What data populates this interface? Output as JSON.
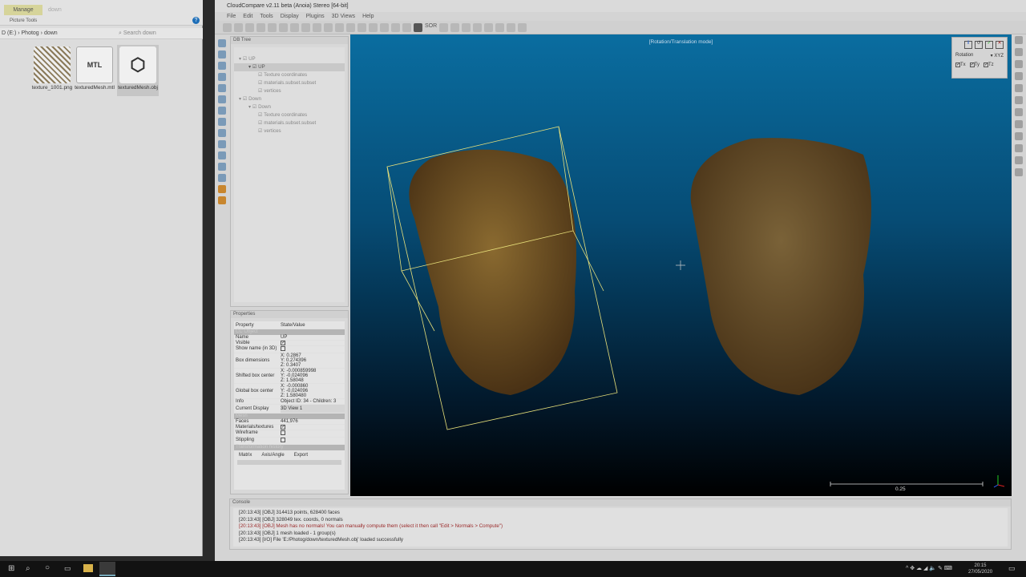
{
  "explorer": {
    "ribbon_tab": "Manage",
    "window_title": "down",
    "ribbon_sub": "Picture Tools",
    "address": [
      "D (E:)",
      "Photog",
      "down"
    ],
    "search_placeholder": "Search down",
    "files": [
      {
        "name": "texture_1001.png"
      },
      {
        "name": "texturedMesh.mtl",
        "icon_text": "MTL"
      },
      {
        "name": "texturedMesh.obj"
      }
    ]
  },
  "app": {
    "title": "CloudCompare v2.11 beta (Anoia) Stereo [64-bit]",
    "menu": [
      "File",
      "Edit",
      "Tools",
      "Display",
      "Plugins",
      "3D Views",
      "Help"
    ],
    "toolbar_labels": {
      "sor": "SOR"
    }
  },
  "db_tree": {
    "title": "DB Tree",
    "items": [
      {
        "label": "UP",
        "level": 0
      },
      {
        "label": "UP",
        "level": 1
      },
      {
        "label": "Texture coordinates",
        "level": 2
      },
      {
        "label": "materials.subset.subset",
        "level": 2
      },
      {
        "label": "vertices",
        "level": 2
      },
      {
        "label": "Down",
        "level": 0
      },
      {
        "label": "Down",
        "level": 1
      },
      {
        "label": "Texture coordinates",
        "level": 2
      },
      {
        "label": "materials.subset.subset",
        "level": 2
      },
      {
        "label": "vertices",
        "level": 2
      }
    ]
  },
  "properties": {
    "title": "Properties",
    "col_property": "Property",
    "col_value": "State/Value",
    "section_cc": "CC Object",
    "name_k": "Name",
    "name_v": "UP",
    "visible_k": "Visible",
    "showname_k": "Show name (in 3D)",
    "box_k": "Box dimensions",
    "box": [
      "X: 0.2867",
      "Y: 0.274396",
      "Z: 0.3407"
    ],
    "shifted_k": "Shifted box center",
    "shifted": [
      "X: -0.000859998",
      "Y: -0.024096",
      "Z: 1.58048"
    ],
    "global_k": "Global box center",
    "global": [
      "X: -0.000860",
      "Y: -0.024096",
      "Z: 1.580480"
    ],
    "info_k": "Info",
    "info_v": "Object ID: 34 - Children: 3",
    "display_k": "Current Display",
    "display_v": "3D View 1",
    "section_mesh": "Mesh",
    "faces_k": "Faces",
    "faces_v": "441,976",
    "mat_k": "Materials/textures",
    "wire_k": "Wireframe",
    "stip_k": "Stippling",
    "section_hist": "Transformation history",
    "tabs": [
      "Matrix",
      "Axis/Angle",
      "Export"
    ]
  },
  "view": {
    "mode_label": "[Rotation/Translation mode]",
    "scale_label": "0.25",
    "transform": {
      "rotation_label": "Rotation",
      "rotation_value": "XYZ",
      "tx": "Tx",
      "ty": "Ty",
      "tz": "Tz"
    }
  },
  "console": {
    "title": "Console",
    "lines": [
      {
        "text": "[20:13:43] [OBJ] 314413 points, 628400 faces",
        "color": "#333333"
      },
      {
        "text": "[20:13:43] [OBJ] 328049 tex. coords, 0 normals",
        "color": "#333333"
      },
      {
        "text": "[20:13:43] [OBJ] Mesh has no normals! You can manually compute them (select it then call \"Edit > Normals > Compute\")",
        "color": "#9a2a2a"
      },
      {
        "text": "[20:13:43] [OBJ] 1 mesh loaded - 1 group(s)",
        "color": "#333333"
      },
      {
        "text": "[20:13:43] [I/O] File 'E:/Photog/down/texturedMesh.obj' loaded successfully",
        "color": "#333333"
      }
    ]
  },
  "taskbar": {
    "time": "20:15",
    "date": "27/05/2020"
  }
}
